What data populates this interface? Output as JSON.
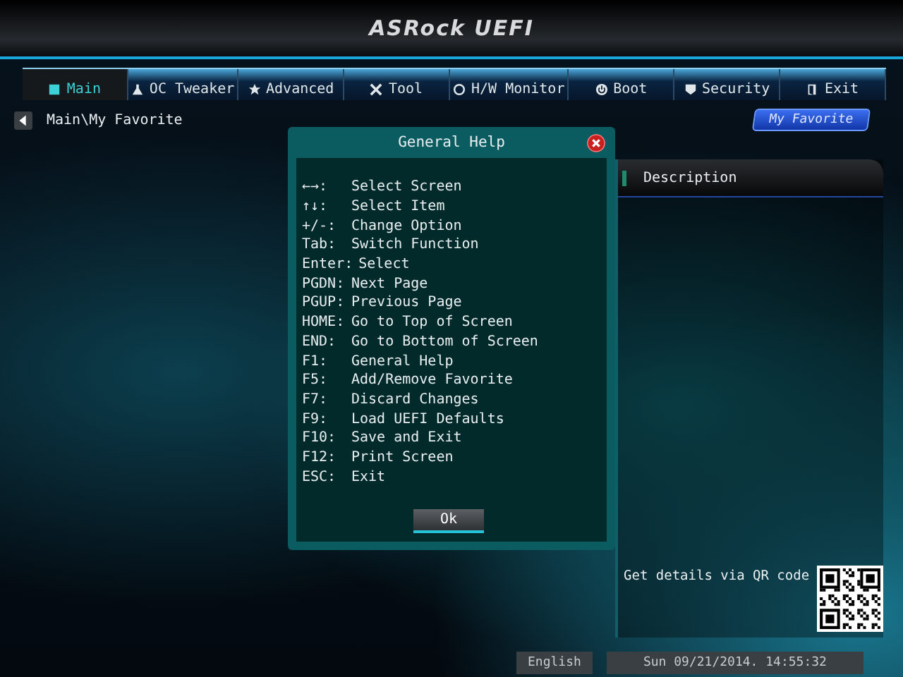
{
  "header": {
    "logo": "ASRock UEFI"
  },
  "tabs": [
    {
      "label": "Main",
      "selected": true
    },
    {
      "label": "OC Tweaker",
      "selected": false
    },
    {
      "label": "Advanced",
      "selected": false
    },
    {
      "label": "Tool",
      "selected": false
    },
    {
      "label": "H/W Monitor",
      "selected": false
    },
    {
      "label": "Boot",
      "selected": false
    },
    {
      "label": "Security",
      "selected": false
    },
    {
      "label": "Exit",
      "selected": false
    }
  ],
  "breadcrumb": "Main\\My Favorite",
  "favorite_button": "My Favorite",
  "dialog": {
    "title": "General Help",
    "lines": [
      {
        "key": "←→:",
        "action": "Select Screen"
      },
      {
        "key": "↑↓:",
        "action": "Select Item"
      },
      {
        "key": "+/-:",
        "action": "Change Option"
      },
      {
        "key": "Tab:",
        "action": "Switch Function"
      },
      {
        "key": "Enter:",
        "action": "Select"
      },
      {
        "key": "PGDN:",
        "action": "Next Page"
      },
      {
        "key": "PGUP:",
        "action": "Previous Page"
      },
      {
        "key": "HOME:",
        "action": "Go to Top of Screen"
      },
      {
        "key": "END:",
        "action": "Go to Bottom of Screen"
      },
      {
        "key": "F1:",
        "action": "General Help"
      },
      {
        "key": "F5:",
        "action": "Add/Remove Favorite"
      },
      {
        "key": "F7:",
        "action": "Discard Changes"
      },
      {
        "key": "F9:",
        "action": "Load UEFI Defaults"
      },
      {
        "key": "F10:",
        "action": "Save and Exit"
      },
      {
        "key": "F12:",
        "action": "Print Screen"
      },
      {
        "key": "ESC:",
        "action": "Exit"
      }
    ],
    "ok": "Ok"
  },
  "description": {
    "title": "Description",
    "qr_caption": "Get details via QR code"
  },
  "status_bar": {
    "language": "English",
    "datetime": "Sun 09/21/2014. 14:55:32"
  }
}
